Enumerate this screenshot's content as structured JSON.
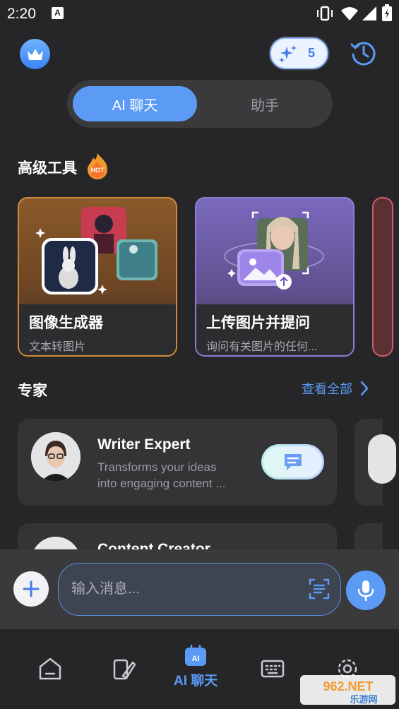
{
  "status_bar": {
    "time": "2:20",
    "a_icon": "A"
  },
  "header": {
    "credits": "5"
  },
  "tabs": {
    "active": "AI 聊天",
    "inactive": "助手"
  },
  "tools_section": {
    "title": "高级工具",
    "hot": "HOT",
    "cards": [
      {
        "title": "图像生成器",
        "subtitle": "文本转图片"
      },
      {
        "title": "上传图片并提问",
        "subtitle": "询问有关图片的任何..."
      }
    ]
  },
  "experts_section": {
    "title": "专家",
    "see_all": "查看全部",
    "items": [
      {
        "name": "Writer Expert",
        "desc_line1": "Transforms your ideas",
        "desc_line2": "into engaging content ..."
      },
      {
        "name": "Content Creator"
      }
    ]
  },
  "input": {
    "placeholder": "输入消息..."
  },
  "nav": {
    "active_label": "AI 聊天",
    "ai_badge": "AI"
  },
  "watermark": {
    "top": "962.NET",
    "bottom": "乐游网"
  },
  "colors": {
    "accent": "#5b9bf5",
    "background": "#262628",
    "card_orange": "#d08a3a",
    "card_purple": "#8c7dd6"
  }
}
